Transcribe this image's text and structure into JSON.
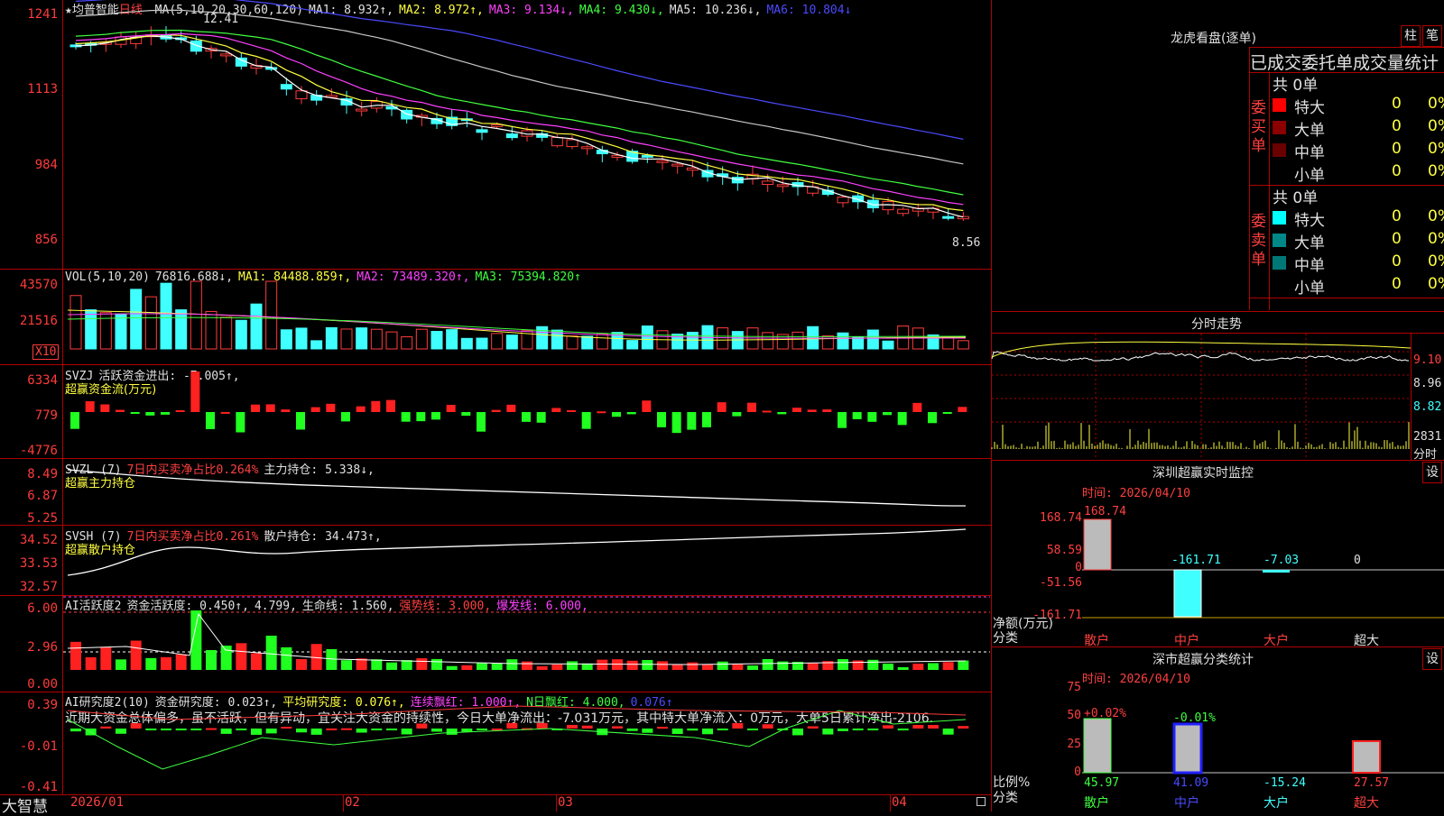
{
  "main": {
    "stock_name": "★均普智能",
    "period": "日线",
    "ma_header": "MA(5,10,20,30,60,120)",
    "ma1": "MA1: 8.932↑,",
    "ma2": "MA2: 8.972↑,",
    "ma3": "MA3: 9.134↓,",
    "ma4": "MA4: 9.430↓,",
    "ma5": "MA5: 10.236↓,",
    "ma6": "MA6: 10.804↓",
    "high_mark": "12.41",
    "low_mark": "8.56",
    "y_ticks": [
      "1241",
      "1113",
      "984",
      "856"
    ]
  },
  "vol": {
    "header": "VOL(5,10,20)",
    "val": "76816.688↓,",
    "ma1": "MA1: 84488.859↑,",
    "ma2": "MA2: 73489.320↑,",
    "ma3": "MA3: 75394.820↑",
    "y_ticks": [
      "43570",
      "21516"
    ],
    "unit": "X10"
  },
  "svzj": {
    "header": "SVZJ",
    "desc": "活跃资金进出: -7.005↑,",
    "sub": "超赢资金流(万元)",
    "y_ticks": [
      "6334",
      "779",
      "-4776"
    ]
  },
  "svzl": {
    "header": "SVZL (7)",
    "desc": "7日内买卖净占比0.264%",
    "desc2": "主力持仓: 5.338↓,",
    "sub": "超赢主力持仓",
    "y_ticks": [
      "8.49",
      "6.87",
      "5.25"
    ]
  },
  "svsh": {
    "header": "SVSH (7)",
    "desc": "7日内买卖净占比0.261%",
    "desc2": "散户持仓: 34.473↑,",
    "sub": "超赢散户持仓",
    "y_ticks": [
      "34.52",
      "33.53",
      "32.57"
    ]
  },
  "ai1": {
    "header": "AI活跃度2",
    "a": "资金活跃度: 0.450↑,",
    "b": "4.799,",
    "c": "生命线: 1.560,",
    "d": "强势线: 3.000,",
    "e": "爆发线: 6.000,",
    "y_ticks": [
      "6.00",
      "2.96",
      "0.00"
    ]
  },
  "ai2": {
    "header": "AI研究度2(10)",
    "a": "资金研究度: 0.023↑,",
    "b": "平均研究度: 0.076↑,",
    "c": "连续飘红: 1.000↑,",
    "d": "N日飘红: 4.000,",
    "e": "0.076↑",
    "comment": "近期大资金总体偏多，虽不活跃，但有异动，宜关注大资金的持续性，今日大单净流出：-7.031万元，其中特大单净流入：0万元，大单5日累计净出-2106.",
    "y_ticks": [
      "0.39",
      "-0.01",
      "-0.41"
    ]
  },
  "xaxis": {
    "brand": "大智慧",
    "labels": [
      "2026/01",
      "02",
      "03",
      "04"
    ]
  },
  "right": {
    "dragon_title": "龙虎看盘(逐单)",
    "btn_bar": "柱",
    "btn_pen": "笔",
    "stats_title": "已成交委托单成交量统计",
    "buy_group": "委买单",
    "sell_group": "委卖单",
    "buy_total": "共 0单",
    "sell_total": "共 0单",
    "buy_rows": [
      {
        "label": "特大",
        "count": "0",
        "pct": "0%",
        "color": "#ff0000"
      },
      {
        "label": "大单",
        "count": "0",
        "pct": "0%",
        "color": "#8b0000"
      },
      {
        "label": "中单",
        "count": "0",
        "pct": "0%",
        "color": "#6a0000"
      },
      {
        "label": "小单",
        "count": "0",
        "pct": "0%",
        "color": "#000000"
      }
    ],
    "sell_rows": [
      {
        "label": "特大",
        "count": "0",
        "pct": "0%",
        "color": "#00ffff"
      },
      {
        "label": "大单",
        "count": "0",
        "pct": "0%",
        "color": "#008888"
      },
      {
        "label": "中单",
        "count": "0",
        "pct": "0%",
        "color": "#007777"
      },
      {
        "label": "小单",
        "count": "0",
        "pct": "0%",
        "color": "#000000"
      }
    ],
    "intraday_title": "分时走势",
    "intraday_ticks": [
      "9.10",
      "8.96",
      "8.82",
      "2831",
      "分时"
    ],
    "sz_monitor_title": "深圳超赢实时监控",
    "sz_monitor_btn": "设",
    "sz_monitor_time": "时间: 2026/04/10",
    "sz_monitor_ticks": [
      "168.74",
      "58.59",
      "0",
      "-51.56",
      "-161.71"
    ],
    "sz_monitor_vals": [
      "168.74",
      "-161.71",
      "-7.03",
      "0"
    ],
    "sz_monitor_ylabel": "净额(万元)",
    "sz_monitor_xlabel": "分类",
    "categories": [
      "散户",
      "中户",
      "大户",
      "超大"
    ],
    "sz_class_title": "深市超赢分类统计",
    "sz_class_btn": "设",
    "sz_class_time": "时间: 2026/04/10",
    "sz_class_ticks": [
      "75",
      "50",
      "25",
      "0"
    ],
    "sz_class_pct": [
      "+0.02%",
      "-0.01%"
    ],
    "sz_class_vals": [
      "45.97",
      "41.09",
      "-15.24",
      "27.57"
    ],
    "sz_class_ylabel": "比例%",
    "sz_class_xlabel": "分类"
  }
}
